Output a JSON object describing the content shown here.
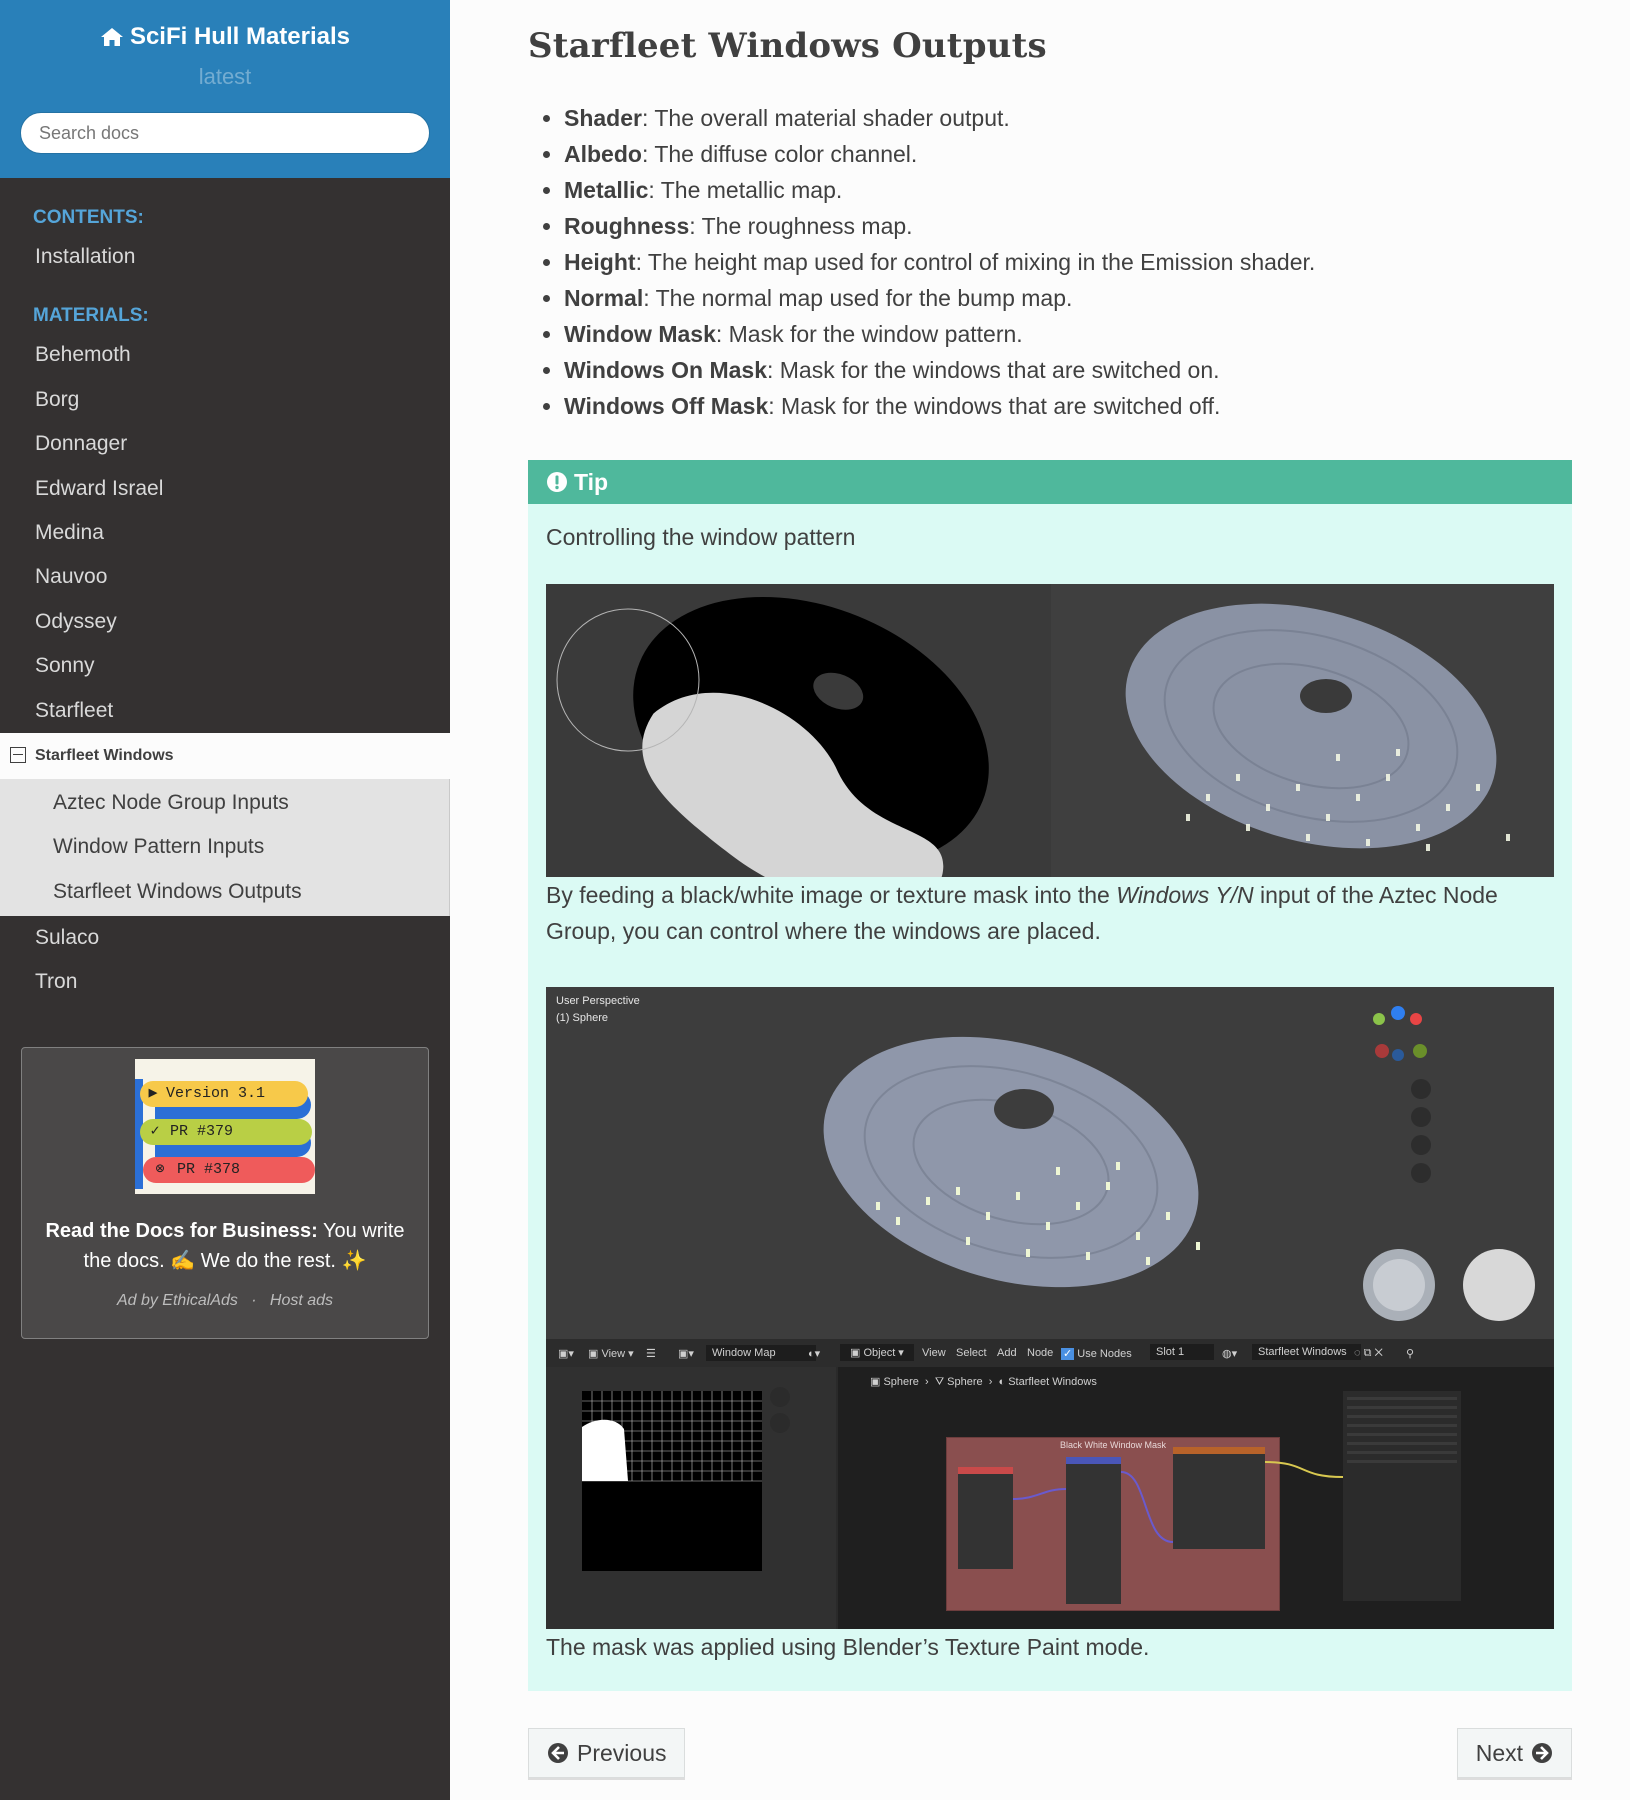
{
  "sidebar": {
    "project_name": "SciFi Hull Materials",
    "version": "latest",
    "search_placeholder": "Search docs",
    "captions": {
      "contents": "CONTENTS:",
      "materials": "MATERIALS:"
    },
    "contents_items": [
      "Installation"
    ],
    "materials_items_before": [
      "Behemoth",
      "Borg",
      "Donnager",
      "Edward Israel",
      "Medina",
      "Nauvoo",
      "Odyssey",
      "Sonny",
      "Starfleet"
    ],
    "current_item": "Starfleet Windows",
    "sub_items": [
      "Aztec Node Group Inputs",
      "Window Pattern Inputs",
      "Starfleet Windows Outputs"
    ],
    "materials_items_after": [
      "Sulaco",
      "Tron"
    ]
  },
  "ad": {
    "pills": [
      "Version 3.1",
      "PR #379",
      "PR #378"
    ],
    "headline": "Read the Docs for Business:",
    "body_1": " You write the docs. ",
    "body_2": " We do the rest. ",
    "emoji_1": "✍",
    "emoji_2": "✨",
    "by": "Ad by EthicalAds",
    "sep": "·",
    "host": "Host ads"
  },
  "page": {
    "title": "Starfleet Windows Outputs",
    "outputs": [
      {
        "name": "Shader",
        "desc": ": The overall material shader output."
      },
      {
        "name": "Albedo",
        "desc": ": The diffuse color channel."
      },
      {
        "name": "Metallic",
        "desc": ": The metallic map."
      },
      {
        "name": "Roughness",
        "desc": ": The roughness map."
      },
      {
        "name": "Height",
        "desc": ": The height map used for control of mixing in the Emission shader."
      },
      {
        "name": "Normal",
        "desc": ": The normal map used for the bump map."
      },
      {
        "name": "Window Mask",
        "desc": ": Mask for the window pattern."
      },
      {
        "name": "Windows On Mask",
        "desc": ": Mask for the windows that are switched on."
      },
      {
        "name": "Windows Off Mask",
        "desc": ": Mask for the windows that are switched off."
      }
    ],
    "tip": {
      "title": "Tip",
      "intro": "Controlling the window pattern",
      "caption1_a": "By feeding a black/white image or texture mask into the ",
      "caption1_em": "Windows Y/N",
      "caption1_b": " input of the Aztec Node Group, you can control where the windows are placed.",
      "caption2": "The mask was applied using Blender’s Texture Paint mode."
    },
    "previous": "Previous",
    "next": "Next"
  },
  "blender": {
    "perspective": "User Perspective",
    "object": "(1) Sphere",
    "view": "View",
    "image_name": "Window Map",
    "mode": "Object",
    "menus": [
      "View",
      "Select",
      "Add",
      "Node"
    ],
    "use_nodes": "Use Nodes",
    "slot": "Slot 1",
    "material": "Starfleet Windows",
    "breadcrumb": [
      "Sphere",
      "Sphere",
      "Starfleet Windows"
    ],
    "frame_label": "Black White Window Mask"
  },
  "colors": {
    "sidebar_bg": "#343131",
    "header_blue": "#2980b9",
    "tip_header": "#4fb89c",
    "tip_bg": "#dbfaf4",
    "caption_blue": "#55a5d9",
    "frame_red": "#8a4f4f"
  }
}
